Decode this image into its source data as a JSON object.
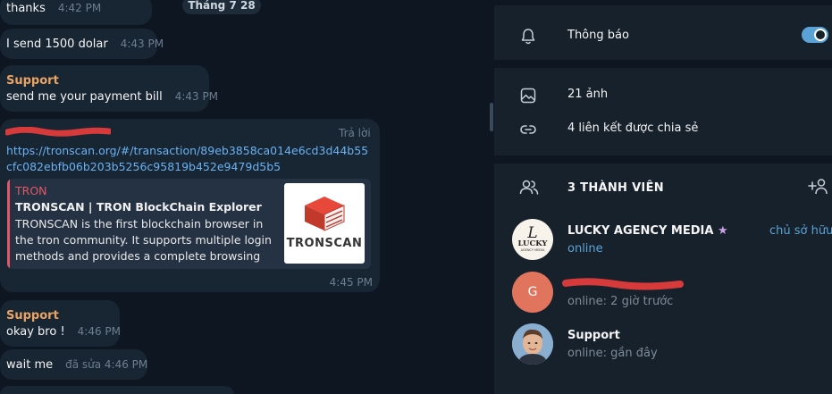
{
  "chat": {
    "messages": [
      {
        "text": "thanks",
        "time": "4:42 PM"
      },
      {
        "text": "I send 1500 dolar",
        "time": "4:43 PM"
      },
      {
        "sender": "Support",
        "text": "send me your payment bill",
        "time": "4:43 PM"
      },
      {
        "reply_label": "Trả lời",
        "link": "https://tronscan.org/#/transaction/89eb3858ca014e6cd3d44b55cfc082ebfb06b203b5256c95819b452e9479d5b5",
        "preview": {
          "site": "TRON",
          "title": "TRONSCAN | TRON BlockChain Explorer",
          "description": "TRONSCAN is the first blockchain browser in the tron community. It supports multiple login methods and provides a complete browsing an...",
          "thumb_text": "TRONSCAN"
        },
        "time": "4:45 PM"
      },
      {
        "sender": "Support",
        "text": "okay bro !",
        "time": "4:46 PM"
      },
      {
        "text": "wait me",
        "time": "đã sửa 4:46 PM"
      }
    ],
    "date_pill": "Tháng 7 28"
  },
  "panel": {
    "notifications": {
      "label": "Thông báo",
      "icon": "bell-icon",
      "enabled": true
    },
    "media": {
      "label": "21 ảnh",
      "icon": "image-icon"
    },
    "links": {
      "label": "4 liên kết được chia sẻ",
      "icon": "link-icon"
    },
    "members_title": "3 THÀNH VIÊN",
    "members": [
      {
        "name": "LUCKY AGENCY MEDIA",
        "status": "online",
        "role": "chủ sở hữu",
        "avatar_text": "LUCKY",
        "avatar_sub": "AGENCY MEDIA"
      },
      {
        "name": "",
        "status": "online: 2 giờ trước",
        "avatar_letter": "G"
      },
      {
        "name": "Support",
        "status": "online: gần đây"
      }
    ]
  },
  "colors": {
    "chat_bg": "#0e1621",
    "bubble": "#182533",
    "panel_bg": "#17212b",
    "accent": "#5ba3d6",
    "sender": "#e9a464",
    "tron_red": "#e05766"
  }
}
